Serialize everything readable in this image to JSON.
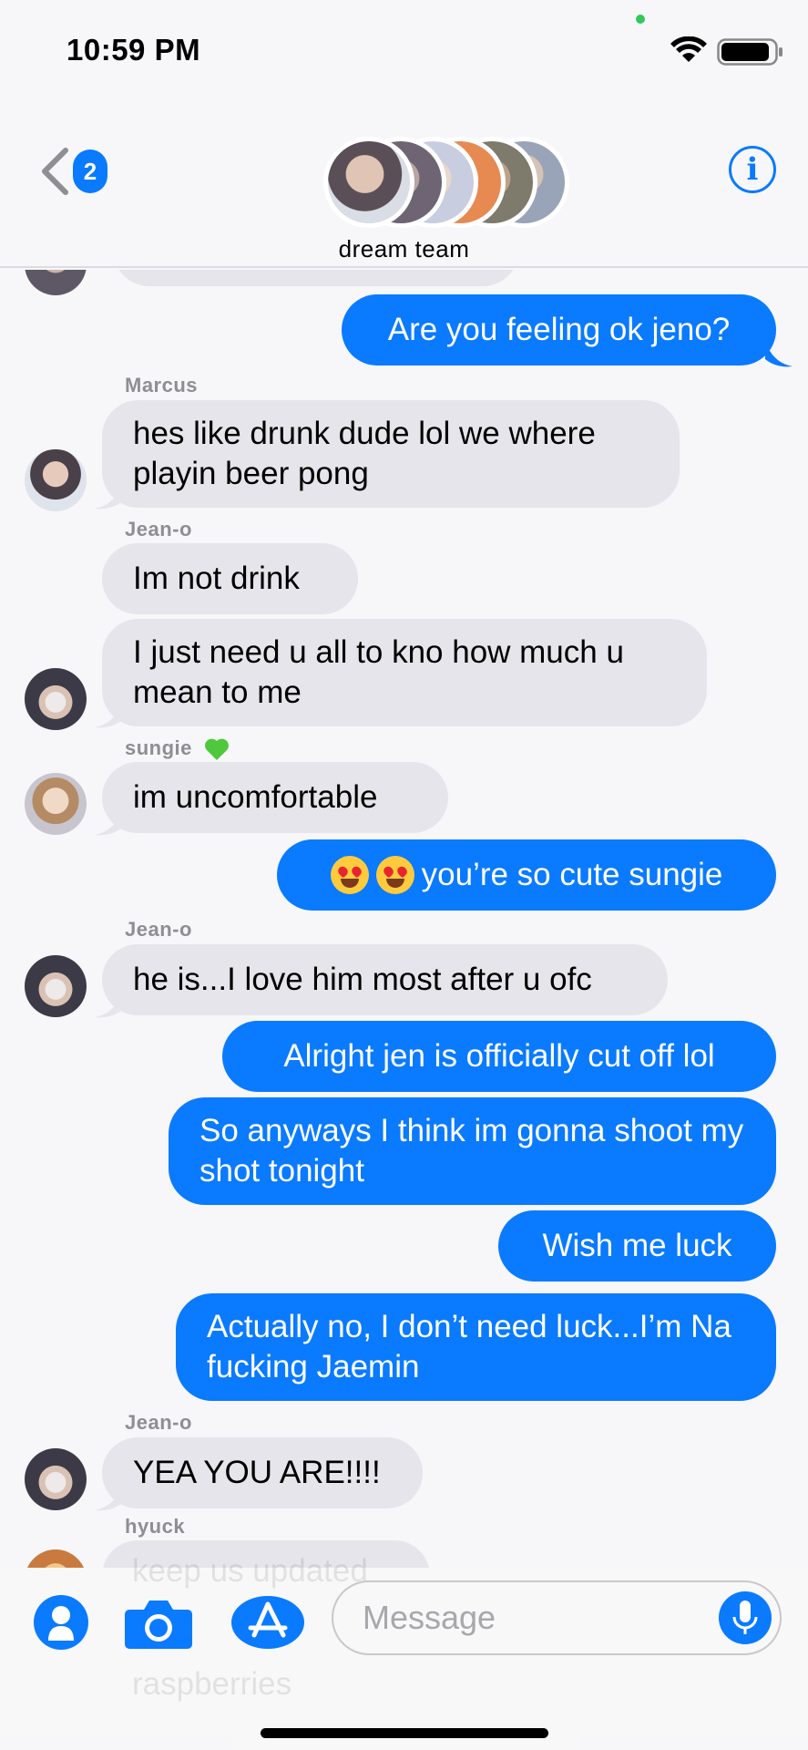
{
  "status_bar": {
    "time": "10:59 PM",
    "wifi_icon": "wifi-icon",
    "battery_icon": "battery-icon"
  },
  "header": {
    "back_badge": "2",
    "group_name": "dream team",
    "info_label": "i"
  },
  "messages": [
    {
      "id": "m1",
      "direction": "out",
      "text": "Are you feeling ok jeno?"
    },
    {
      "id": "s1",
      "sender": "Marcus"
    },
    {
      "id": "m2",
      "direction": "in",
      "text": "hes like drunk dude lol we where playin beer pong"
    },
    {
      "id": "s2",
      "sender": "Jean-o"
    },
    {
      "id": "m3",
      "direction": "in",
      "text": "Im not drink"
    },
    {
      "id": "m4",
      "direction": "in",
      "text": "I just need u all to kno how much u mean to me"
    },
    {
      "id": "s3",
      "sender": "sungie",
      "sender_emoji": "green-heart"
    },
    {
      "id": "m5",
      "direction": "in",
      "text": "im uncomfortable"
    },
    {
      "id": "m6",
      "direction": "out",
      "text": "you’re so cute sungie",
      "prefix_emoji": "heart-eyes-emoji x2"
    },
    {
      "id": "s4",
      "sender": "Jean-o"
    },
    {
      "id": "m7",
      "direction": "in",
      "text": "he is...I love him most after u ofc"
    },
    {
      "id": "m8",
      "direction": "out",
      "text": "Alright jen is officially cut off lol"
    },
    {
      "id": "m9",
      "direction": "out",
      "text": "So anyways I think im gonna shoot my shot tonight"
    },
    {
      "id": "m10",
      "direction": "out",
      "text": "Wish me luck"
    },
    {
      "id": "m11",
      "direction": "out",
      "text": "Actually no, I don’t need luck...I’m Na fucking Jaemin"
    },
    {
      "id": "s5",
      "sender": "Jean-o"
    },
    {
      "id": "m12",
      "direction": "in",
      "text": "YEA YOU ARE!!!!"
    },
    {
      "id": "s6",
      "sender": "hyuck"
    }
  ],
  "sender_labels": {
    "marcus": "Marcus",
    "jeano_1": "Jean-o",
    "sungie": "sungie",
    "jeano_2": "Jean-o",
    "jeano_3": "Jean-o",
    "hyuck": "hyuck"
  },
  "texts": {
    "m1": "Are you feeling ok jeno?",
    "m2": "hes like drunk dude lol we where playin beer pong",
    "m3": "Im not drink",
    "m4": "I just need u all to kno how much u mean to me",
    "m5": "im uncomfortable",
    "m6": "you’re so cute sungie",
    "m7": "he is...I love him most after u ofc",
    "m8": "Alright jen is officially cut off lol",
    "m9": "So anyways I think im gonna shoot my shot tonight",
    "m10": "Wish me luck",
    "m11": "Actually no, I don’t need luck...I’m Na fucking Jaemin",
    "m12": "YEA YOU ARE!!!!",
    "behind_1": "keep us updated",
    "behind_2": "raspberries"
  },
  "input": {
    "placeholder": "Message"
  },
  "colors": {
    "accent": "#0a7aff",
    "incoming_bubble": "#e6e5eb",
    "background": "#f7f7f9",
    "sender_label": "#8e8e93"
  }
}
